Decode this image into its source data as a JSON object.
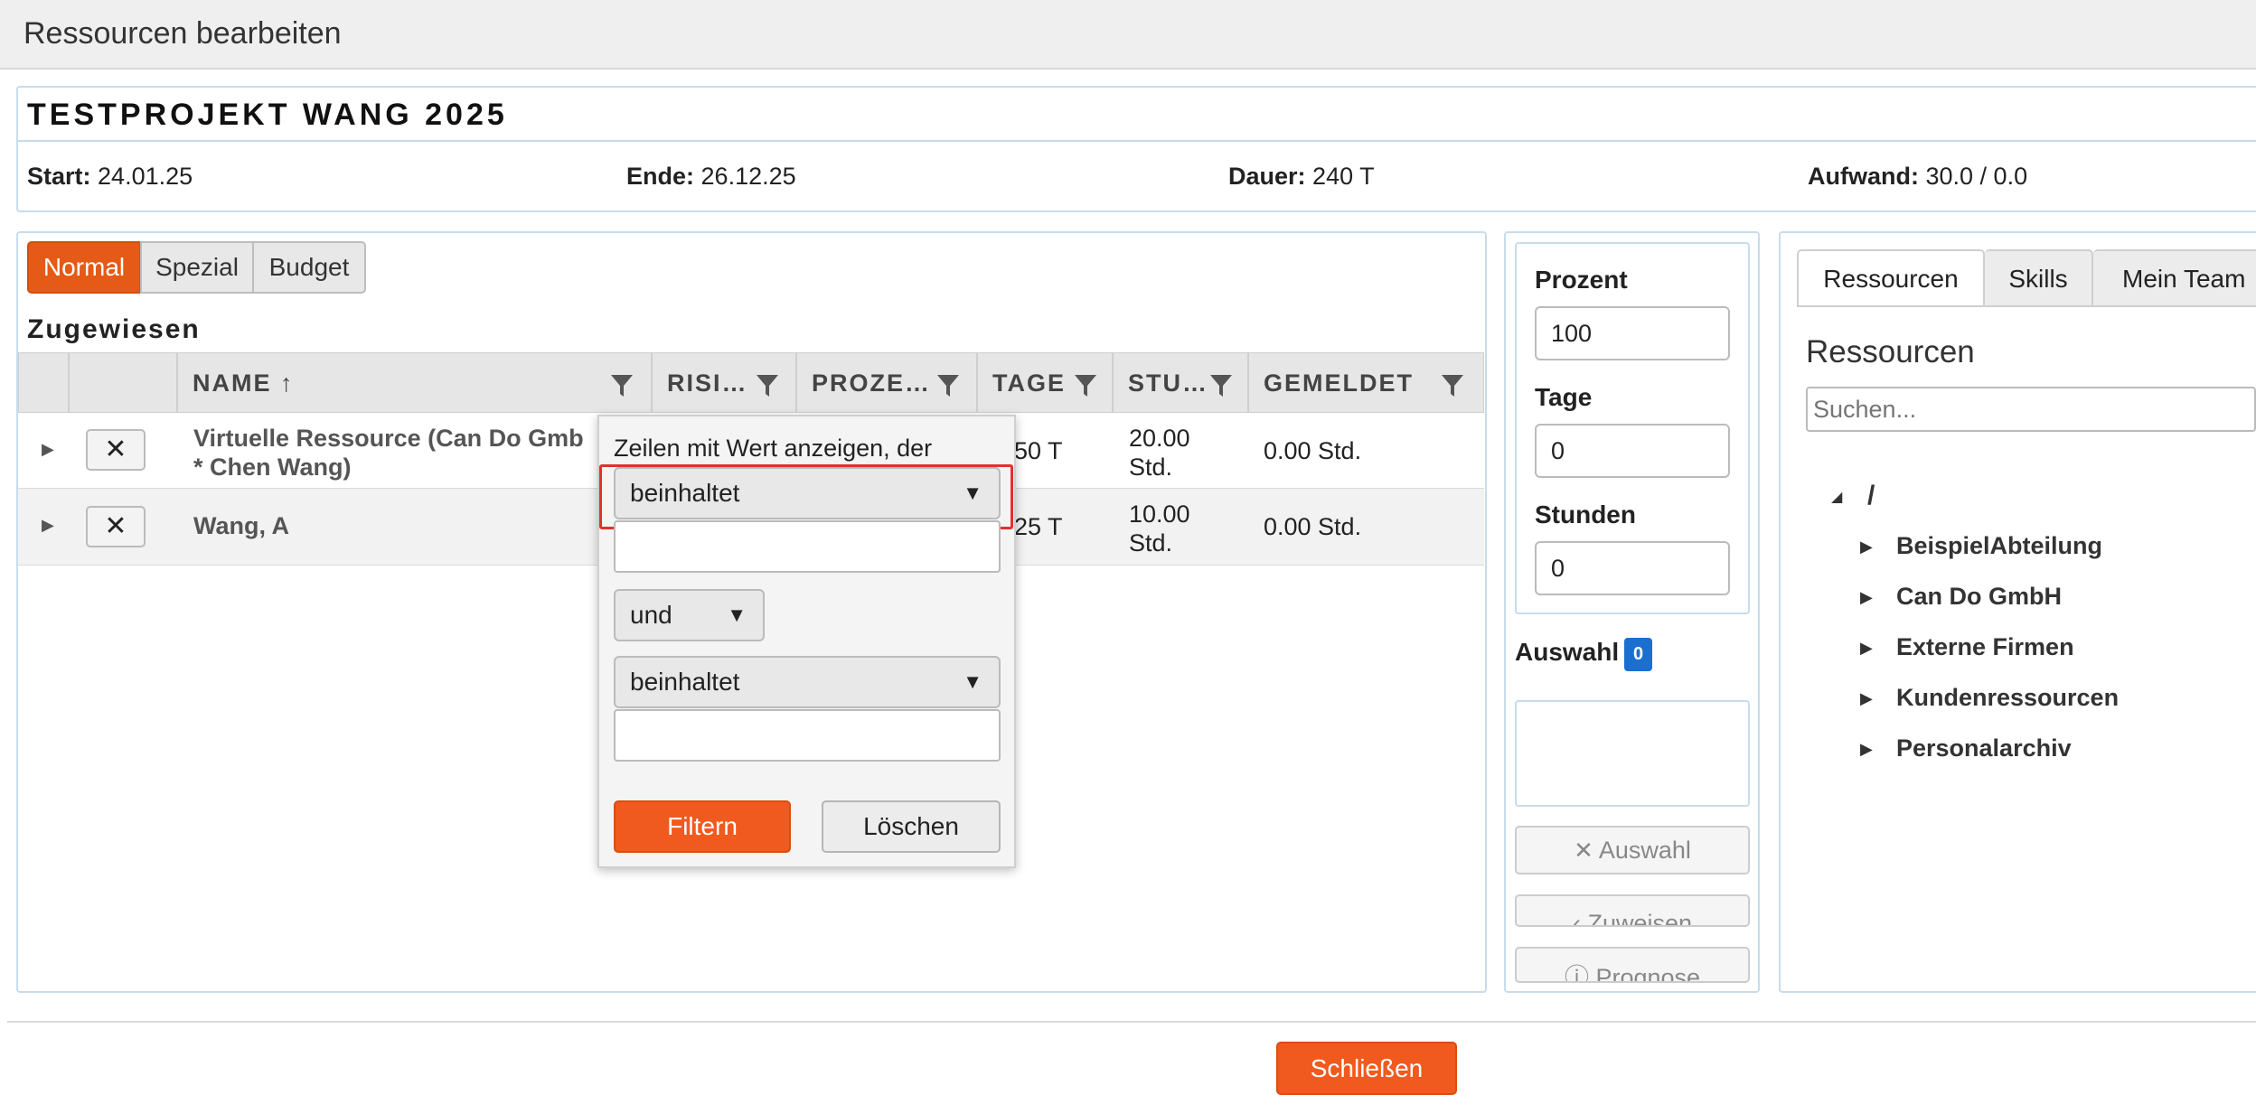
{
  "window": {
    "title": "Ressourcen bearbeiten"
  },
  "project": {
    "name": "TESTPROJEKT WANG 2025",
    "start_label": "Start:",
    "start": "24.01.25",
    "end_label": "Ende:",
    "end": "26.12.25",
    "duration_label": "Dauer:",
    "duration": "240 T",
    "effort_label": "Aufwand:",
    "effort": "30.0 / 0.0"
  },
  "view_tabs": [
    {
      "label": "Normal",
      "active": true
    },
    {
      "label": "Spezial",
      "active": false
    },
    {
      "label": "Budget",
      "active": false
    }
  ],
  "assigned": {
    "heading": "Zugewiesen",
    "columns": [
      {
        "label": "NAME",
        "sort_arrow": "↑"
      },
      {
        "label": "RISI…"
      },
      {
        "label": "PROZE…"
      },
      {
        "label": "TAGE"
      },
      {
        "label": "STU…"
      },
      {
        "label": "GEMELDET"
      }
    ],
    "rows": [
      {
        "name_line1": "Virtuelle Ressource (Can Do Gmb",
        "name_line2": "* Chen Wang)",
        "days": "50 T",
        "hours_line1": "20.00",
        "hours_line2": "Std.",
        "reported": "0.00 Std."
      },
      {
        "name_line1": "Wang, A",
        "name_line2": "",
        "days": "25 T",
        "hours_line1": "10.00",
        "hours_line2": "Std.",
        "reported": "0.00 Std."
      }
    ],
    "remove_icon": "✕"
  },
  "filter_popup": {
    "title": "Zeilen mit Wert anzeigen, der",
    "operator1": "beinhaltet",
    "value1": "",
    "logic": "und",
    "operator2": "beinhaltet",
    "value2": "",
    "filter_button": "Filtern",
    "clear_button": "Löschen"
  },
  "allocation": {
    "percent_label": "Prozent",
    "percent_value": "100",
    "days_label": "Tage",
    "days_value": "0",
    "hours_label": "Stunden",
    "hours_value": "0",
    "selection_label": "Auswahl",
    "selection_count": "0",
    "clear_selection_button": "Auswahl",
    "assign_button": "Zuweisen",
    "forecast_button": "Prognose"
  },
  "resource_tabs": [
    {
      "label": "Ressourcen",
      "active": true
    },
    {
      "label": "Skills",
      "active": false
    },
    {
      "label": "Mein Team",
      "active": false
    }
  ],
  "resources": {
    "heading": "Ressourcen",
    "search_placeholder": "Suchen...",
    "root": "/",
    "tree": [
      "BeispielAbteilung",
      "Can Do GmbH",
      "Externe Firmen",
      "Kundenressourcen",
      "Personalarchiv"
    ]
  },
  "footer": {
    "close_button": "Schließen"
  },
  "colors": {
    "accent": "#f15a1e",
    "highlight": "#e0322b",
    "badge": "#1a6fd1"
  }
}
